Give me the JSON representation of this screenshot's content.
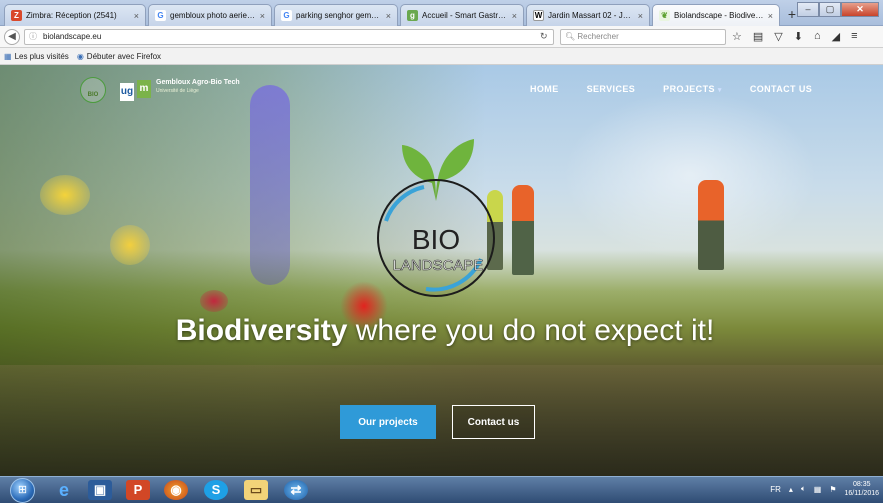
{
  "browser": {
    "tabs": [
      {
        "label": "Zimbra: Réception (2541)",
        "icon": "zimbra-icon",
        "active": false
      },
      {
        "label": "gembloux photo aerien...",
        "icon": "google-icon",
        "active": false
      },
      {
        "label": "parking senghor gembl...",
        "icon": "google-icon",
        "active": false
      },
      {
        "label": "Accueil - Smart Gastron...",
        "icon": "gastro-icon",
        "active": false
      },
      {
        "label": "Jardin Massart 02 - Jardi...",
        "icon": "wikipedia-icon",
        "active": false
      },
      {
        "label": "Biolandscape - Biodiver...",
        "icon": "biolandscape-icon",
        "active": true
      }
    ],
    "tab_close": "×",
    "new_tab": "+",
    "window_controls": {
      "minimize": "–",
      "maximize": "▢",
      "close": "✕"
    },
    "url": "biolandscape.eu",
    "search_placeholder": "Rechercher",
    "bookmarks": [
      "Les plus visités",
      "Débuter avec Firefox"
    ]
  },
  "site": {
    "logos": {
      "bio_mini": "BIO",
      "ulg": "ug",
      "gbx": "m",
      "gbx_title": "Gembloux Agro-Bio Tech",
      "gbx_subtitle": "Université de Liège"
    },
    "nav": [
      {
        "label": "HOME"
      },
      {
        "label": "SERVICES"
      },
      {
        "label": "PROJECTS",
        "has_dropdown": true
      },
      {
        "label": "CONTACT US"
      }
    ],
    "main_logo": {
      "line1": "BIO",
      "line2": "LANDSCAPE"
    },
    "hero": {
      "strong": "Biodiversity",
      "rest": " where you do not expect it!"
    },
    "buttons": {
      "projects": "Our projects",
      "contact": "Contact us"
    }
  },
  "taskbar": {
    "language": "FR",
    "time": "08:35",
    "date": "16/11/2016"
  },
  "colors": {
    "accent_button": "#2f9ad8",
    "logo_green": "#6fb43d",
    "logo_blue": "#3aa3d8"
  }
}
